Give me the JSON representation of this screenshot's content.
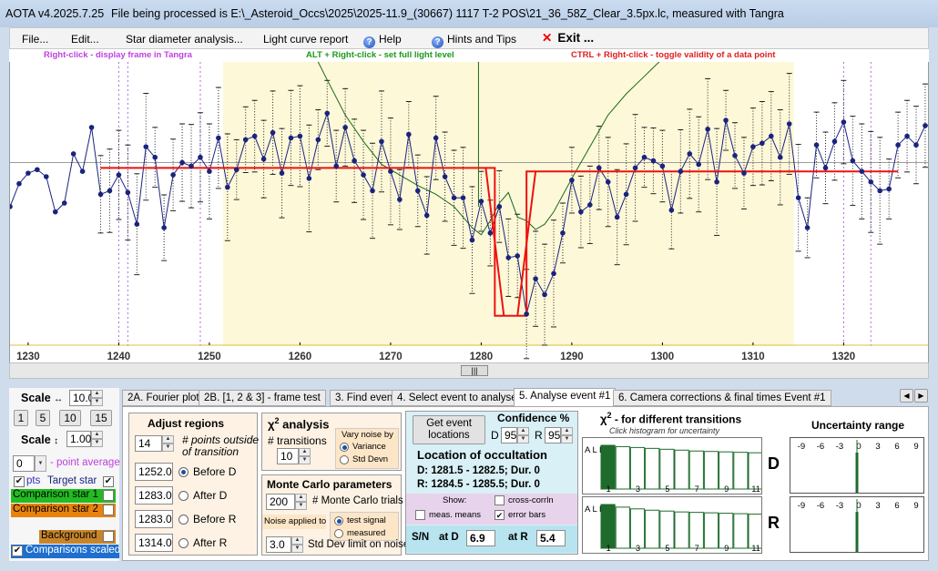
{
  "title": {
    "app": "AOTA v4.2025.7.25",
    "file": "File being processed is E:\\_Asteroid_Occs\\2025\\2025-11.9_(30667) 1117 T-2 POS\\21_36_58Z_Clear_3.5px.lc, measured with Tangra"
  },
  "menu": {
    "file": "File...",
    "edit": "Edit...",
    "star_diameter": "Star diameter analysis...",
    "light_curve": "Light curve report",
    "help": "Help",
    "hints": "Hints and Tips",
    "exit": "Exit ..."
  },
  "hints": {
    "right_click": "Right-click  -  display frame in Tangra",
    "alt_right": "ALT + Right-click  -  set full light level",
    "ctrl_right": "CTRL + Right-click  -  toggle validity of a data point",
    "colors": {
      "right_click": "#c040e0",
      "alt_right": "#1a9a1a",
      "ctrl_right": "#e02020"
    }
  },
  "plot": {
    "x_range": [
      1226,
      1326
    ],
    "y_range": [
      -0.15,
      1.35
    ],
    "x_ticks": [
      1230,
      1240,
      1250,
      1260,
      1270,
      1280,
      1290,
      1300,
      1310,
      1320
    ],
    "x_tick_labels": [
      "1230",
      "1240",
      "1250",
      "1260",
      "1270",
      "1280",
      "1290",
      "1300",
      "1310",
      "1320"
    ],
    "selection_regions": [
      [
        1252,
        1283
      ],
      [
        1283,
        1314
      ]
    ],
    "baseline_level": 0.8,
    "event_level": 0.0,
    "disappearance_frame": 1281.5,
    "reappearance_frame": 1285,
    "colors": {
      "points": "#1a237e",
      "fit": "#ee1111",
      "noise": "#1a6a1a",
      "region": "#fdf8d8"
    },
    "points_y": [
      0.31,
      0.91,
      0.58,
      0.71,
      0.77,
      0.79,
      0.75,
      0.55,
      0.6,
      0.88,
      0.78,
      1.03,
      0.65,
      0.67,
      0.76,
      0.66,
      0.48,
      0.92,
      0.86,
      0.46,
      0.76,
      0.83,
      0.81,
      0.86,
      0.78,
      0.97,
      0.69,
      0.79,
      0.96,
      0.98,
      0.85,
      1.0,
      0.77,
      0.97,
      0.98,
      0.74,
      0.96,
      1.11,
      0.81,
      1.03,
      0.84,
      0.76,
      0.67,
      0.95,
      0.78,
      0.62,
      0.99,
      0.67,
      0.53,
      0.97,
      0.75,
      0.63,
      0.63,
      0.39,
      0.61,
      0.43,
      0.58,
      0.29,
      0.3,
      -0.03,
      0.17,
      0.08,
      0.2,
      0.43,
      0.73,
      0.55,
      0.59,
      0.8,
      0.72,
      0.52,
      0.65,
      0.8,
      0.86,
      0.84,
      0.81,
      0.56,
      0.78,
      0.88,
      0.82,
      1.02,
      0.72,
      1.07,
      0.87,
      0.77,
      0.92,
      0.94,
      0.98,
      0.86,
      1.05,
      0.63,
      0.46,
      0.93,
      0.8,
      0.95,
      1.06,
      0.84,
      0.78,
      0.72,
      0.67,
      0.68,
      0.93,
      0.98,
      0.93,
      1.04,
      1.05,
      1.04,
      1.0,
      0.77,
      0.68,
      0.91,
      1.03,
      0.73,
      0.71,
      0.86,
      0.78,
      0.92,
      0.87,
      0.72,
      0.65,
      0.74
    ]
  },
  "left": {
    "scale_label": "Scale",
    "scale_value": "10.0",
    "buttons": [
      "1",
      "5",
      "10",
      "15"
    ],
    "scale2_label": "Scale",
    "scale2_value": "1.00",
    "point_avg_value": "0",
    "point_avg_label": "- point average",
    "pts_label": "pts",
    "target_label": "Target star",
    "comp1_label": "Comparison star 1",
    "comp2_label": "Comparison star 2",
    "background_label": "Background",
    "comps_scaled_label": "Comparisons scaled",
    "colors": {
      "comp1": "#22bb22",
      "comp2": "#e8820c",
      "background": "#c8842c",
      "comps_scaled": "#1e6fcf"
    }
  },
  "tabs": [
    "2A. Fourier plot",
    "2B. [1, 2 & 3] - frame test",
    "3. Find events",
    "4. Select event to analyse",
    "5. Analyse event #1",
    "6. Camera corrections & final times Event #1"
  ],
  "adjust": {
    "title": "Adjust regions",
    "points_value": "14",
    "points_label": "# points outside of transition",
    "rows": [
      {
        "value": "1252.0",
        "label": "Before D",
        "selected": true
      },
      {
        "value": "1283.0",
        "label": "After D",
        "selected": false
      },
      {
        "value": "1283.0",
        "label": "Before R",
        "selected": false
      },
      {
        "value": "1314.0",
        "label": "After R",
        "selected": false
      }
    ]
  },
  "chi": {
    "title": "χ",
    "sup": "2",
    "title_rest": " analysis",
    "transitions_label": "# transitions",
    "transitions_value": "10",
    "vary_title": "Vary noise by",
    "vary_options": [
      "Variance",
      "Std Devn"
    ]
  },
  "monte": {
    "title": "Monte Carlo parameters",
    "trials_value": "200",
    "trials_label": "# Monte Carlo trials",
    "noise_label": "Noise applied to",
    "noise_options": [
      "test signal",
      "measured"
    ],
    "sd_value": "3.0",
    "sd_label": "Std Dev limit on noise"
  },
  "events": {
    "get_button": "Get event locations",
    "confidence": "Confidence %",
    "d_label": "D",
    "d_value": "95",
    "r_label": "R",
    "r_value": "95",
    "location_title": "Location of occultation",
    "d_line": "D: 1281.5 - 1282.5; Dur. 0",
    "r_line": "R: 1284.5 - 1285.5; Dur. 0",
    "show_label": "Show:",
    "cross_corr": "cross-corrln",
    "meas_means": "meas. means",
    "error_bars": "error bars",
    "sn_label": "S/N",
    "at_d": "at D",
    "sn_d": "6.9",
    "at_r": "at R",
    "sn_r": "5.4"
  },
  "chi2panel": {
    "title_a": "χ",
    "title_sup": "2",
    "title_b": " - for different transitions",
    "subtitle": "Click histogram for uncertainty",
    "all_label": "A L L",
    "hist_labels": [
      "1",
      "3",
      "5",
      "7",
      "9",
      "11"
    ],
    "hist_d": [
      1.0,
      0.97,
      0.95,
      0.93,
      0.91,
      0.89,
      0.87,
      0.86,
      0.85,
      0.84,
      0.83
    ],
    "hist_r": [
      1.0,
      0.94,
      0.9,
      0.87,
      0.85,
      0.83,
      0.82,
      0.81,
      0.8,
      0.79,
      0.78
    ],
    "d_big": "D",
    "r_big": "R"
  },
  "uncertainty": {
    "title": "Uncertainty range",
    "ticks": [
      "-9",
      "-6",
      "-3",
      "0",
      "3",
      "6",
      "9"
    ]
  }
}
